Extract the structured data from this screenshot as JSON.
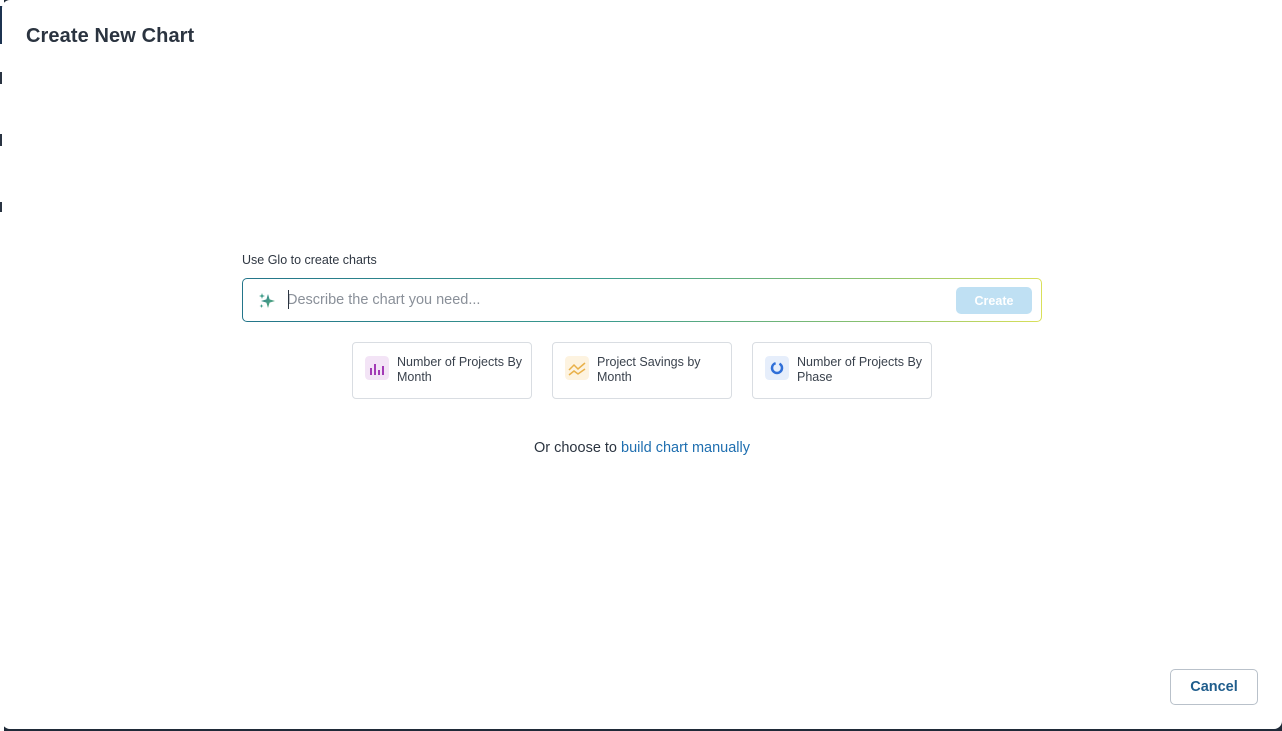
{
  "modal": {
    "title": "Create New Chart"
  },
  "glo": {
    "label": "Use Glo to create charts",
    "input_value": "",
    "placeholder": "Describe the chart you need...",
    "create_label": "Create"
  },
  "suggestions": [
    {
      "label": "Number of Projects By Month",
      "icon": "bar-chart-icon"
    },
    {
      "label": "Project Savings by Month",
      "icon": "line-chart-icon"
    },
    {
      "label": "Number of Projects By Phase",
      "icon": "donut-chart-icon"
    }
  ],
  "manual": {
    "prefix": "Or choose to ",
    "link_label": "build chart manually"
  },
  "footer": {
    "cancel_label": "Cancel"
  },
  "colors": {
    "accent": "#1f6fb0",
    "create_disabled": "#bfe0f3",
    "bar_icon": "#a23ab5",
    "line_icon": "#e9b14a",
    "donut_icon": "#2f6fd8"
  }
}
